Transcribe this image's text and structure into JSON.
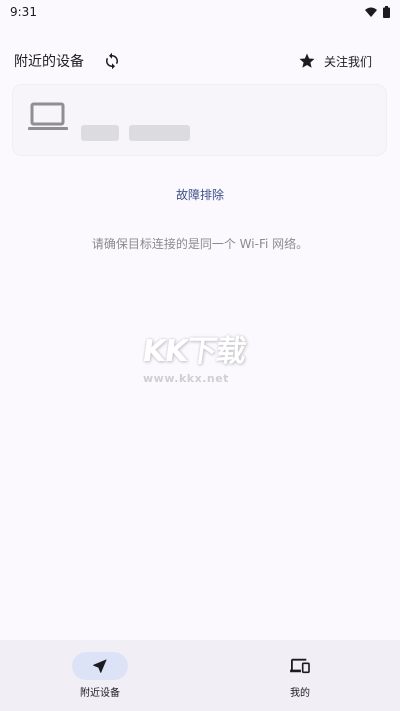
{
  "status_bar": {
    "time": "9:31",
    "wifi_icon": "wifi-icon",
    "battery_icon": "battery-icon"
  },
  "app_bar": {
    "title": "附近的设备",
    "refresh_icon": "refresh-icon",
    "follow_label": "关注我们",
    "follow_icon": "star-icon"
  },
  "device_card": {
    "icon": "laptop-icon"
  },
  "troubleshoot_label": "故障排除",
  "hint_text": "请确保目标连接的是同一个 Wi-Fi 网络。",
  "watermark": {
    "logo": "KK下载",
    "url": "www.kkx.net"
  },
  "bottom_nav": {
    "items": [
      {
        "label": "附近设备",
        "icon": "navigation-arrow-icon",
        "active": true
      },
      {
        "label": "我的",
        "icon": "devices-icon",
        "active": false
      }
    ]
  },
  "colors": {
    "background": "#fcf9fe",
    "accent_link": "#3c4f8a",
    "nav_active_pill": "#dde3f6",
    "nav_background": "#f1eef6"
  }
}
